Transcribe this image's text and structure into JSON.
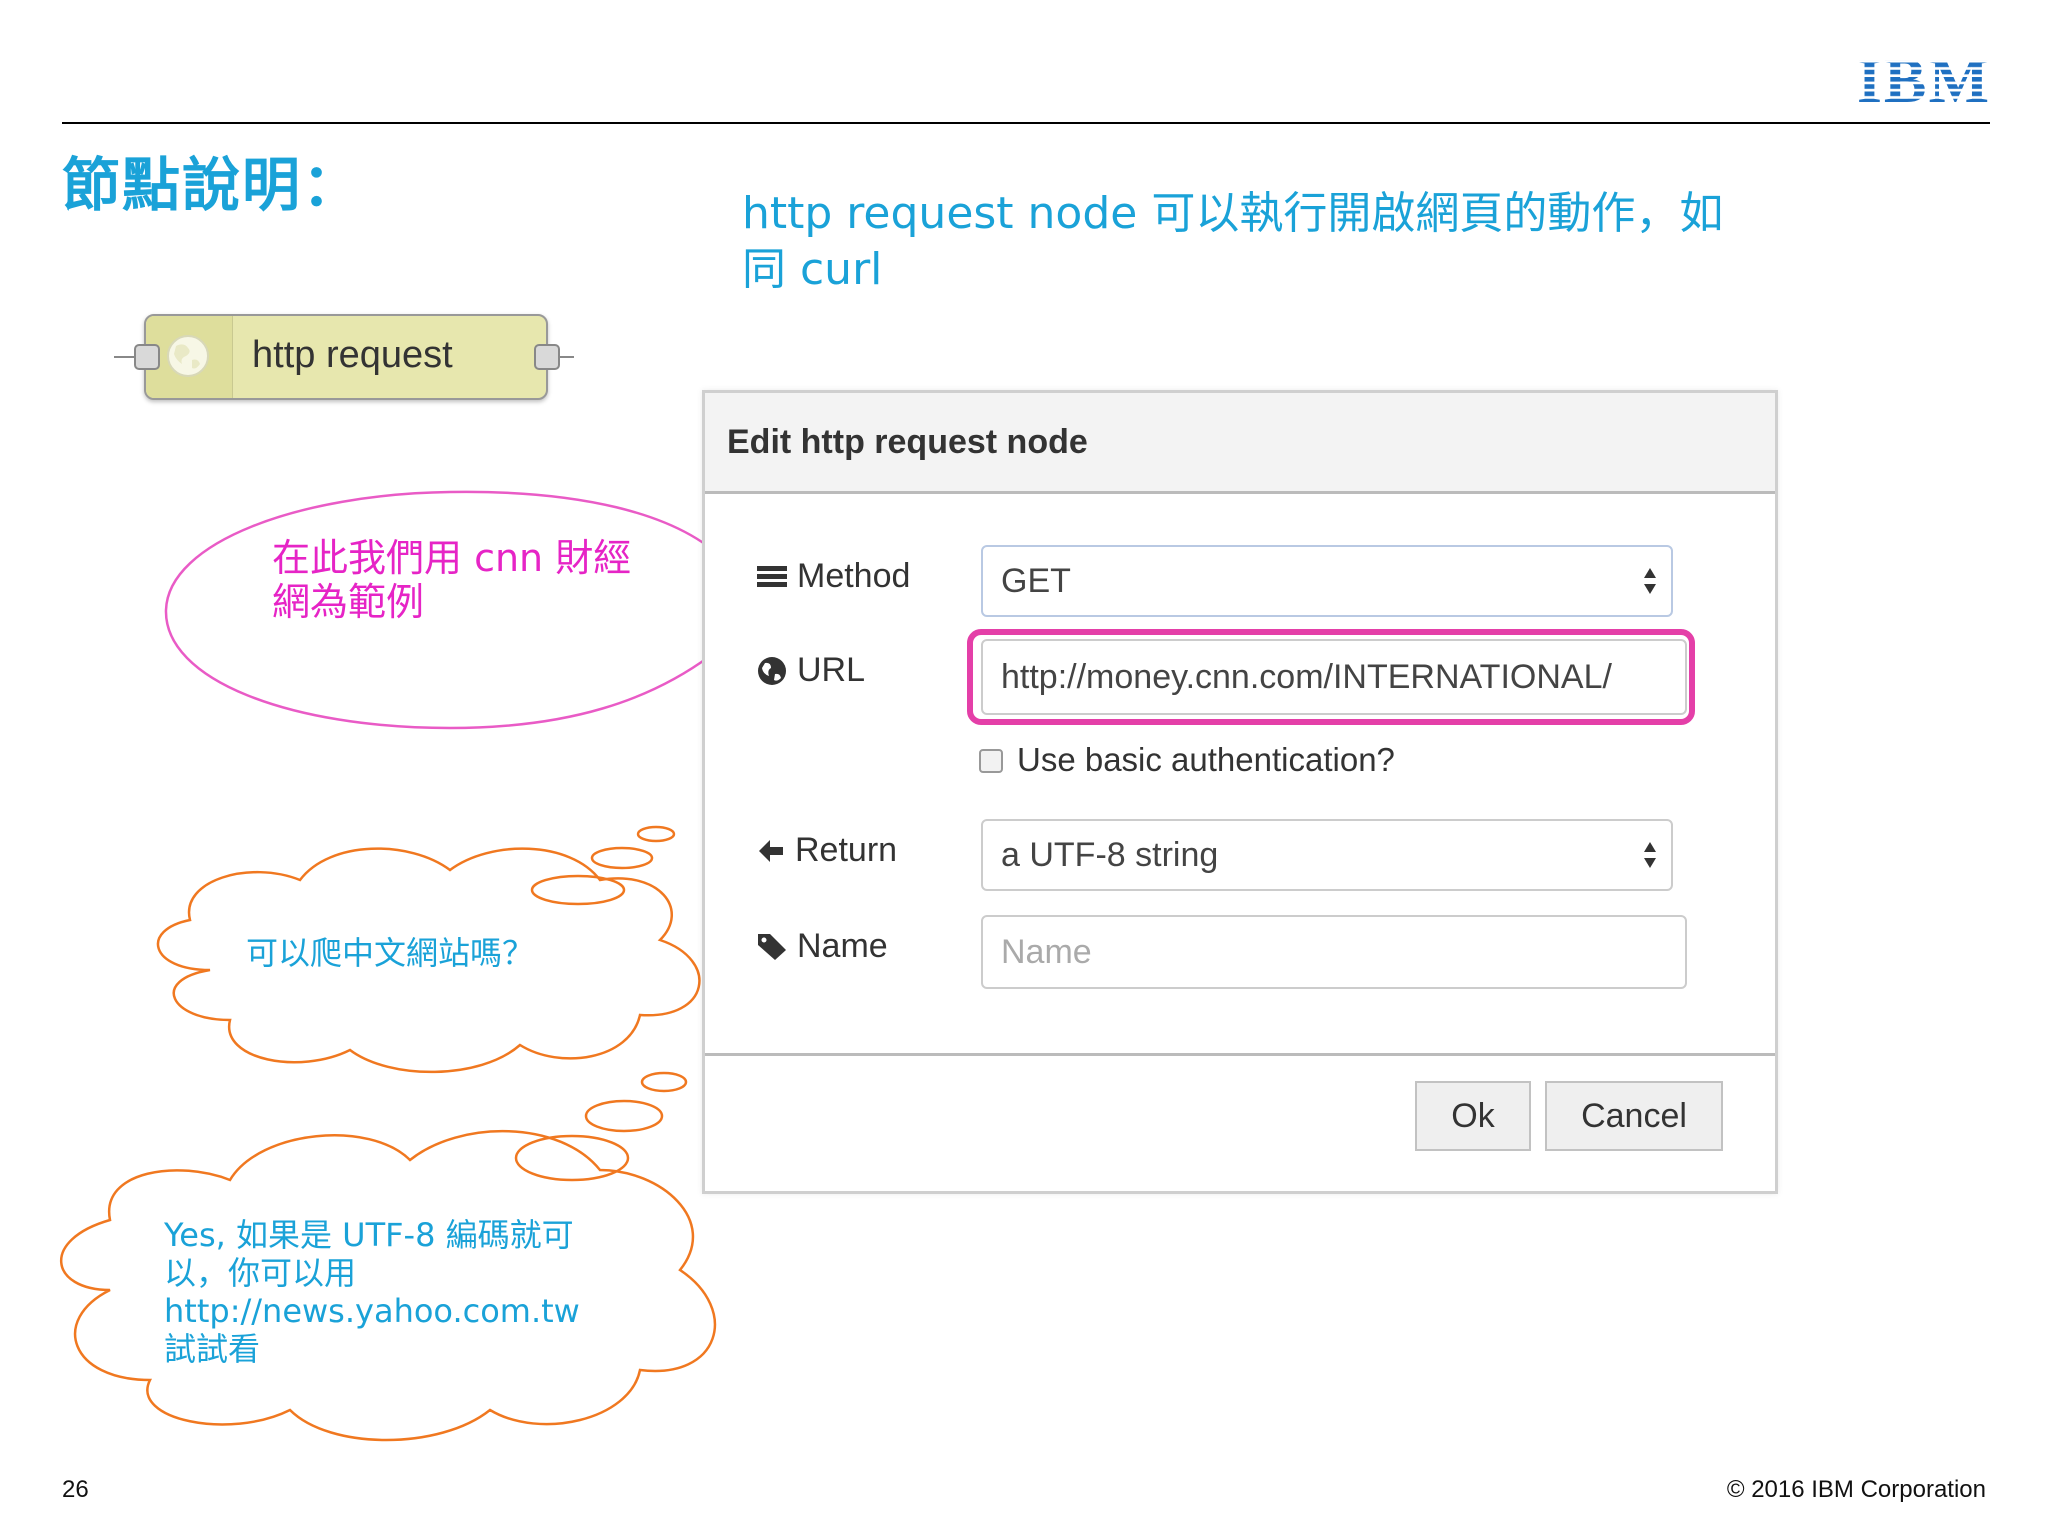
{
  "slide": {
    "title": "節點說明：",
    "intro": "http request node  可以執行開啟網頁的動作，如同 curl",
    "page_number": "26",
    "copyright": "© 2016 IBM Corporation",
    "logo_text": "IBM"
  },
  "node": {
    "label": "http request",
    "icon": "globe-icon",
    "fill_color": "#e7e7ae"
  },
  "dialog": {
    "title": "Edit http request node",
    "method": {
      "label": "Method",
      "value": "GET",
      "icon": "list-icon"
    },
    "url": {
      "label": "URL",
      "value": "http://money.cnn.com/INTERNATIONAL/",
      "icon": "globe-icon"
    },
    "auth": {
      "label": "Use basic authentication?",
      "checked": false
    },
    "return": {
      "label": "Return",
      "value": "a UTF-8 string",
      "icon": "arrow-left-icon"
    },
    "name": {
      "label": "Name",
      "placeholder": "Name",
      "value": "",
      "icon": "tag-icon"
    },
    "ok_label": "Ok",
    "cancel_label": "Cancel"
  },
  "callouts": {
    "speech": "在此我們用 cnn 財經網為範例",
    "speech_color": "#e624c6",
    "cloud_question": "可以爬中文網站嗎？",
    "cloud_answer": "Yes, 如果是 UTF-8 編碼就可以，你可以用 http://news.yahoo.com.tw 試試看",
    "cloud_color": "#f07820"
  },
  "colors": {
    "accent_blue": "#1aa2d8",
    "highlight_pink": "#e43fa8"
  }
}
